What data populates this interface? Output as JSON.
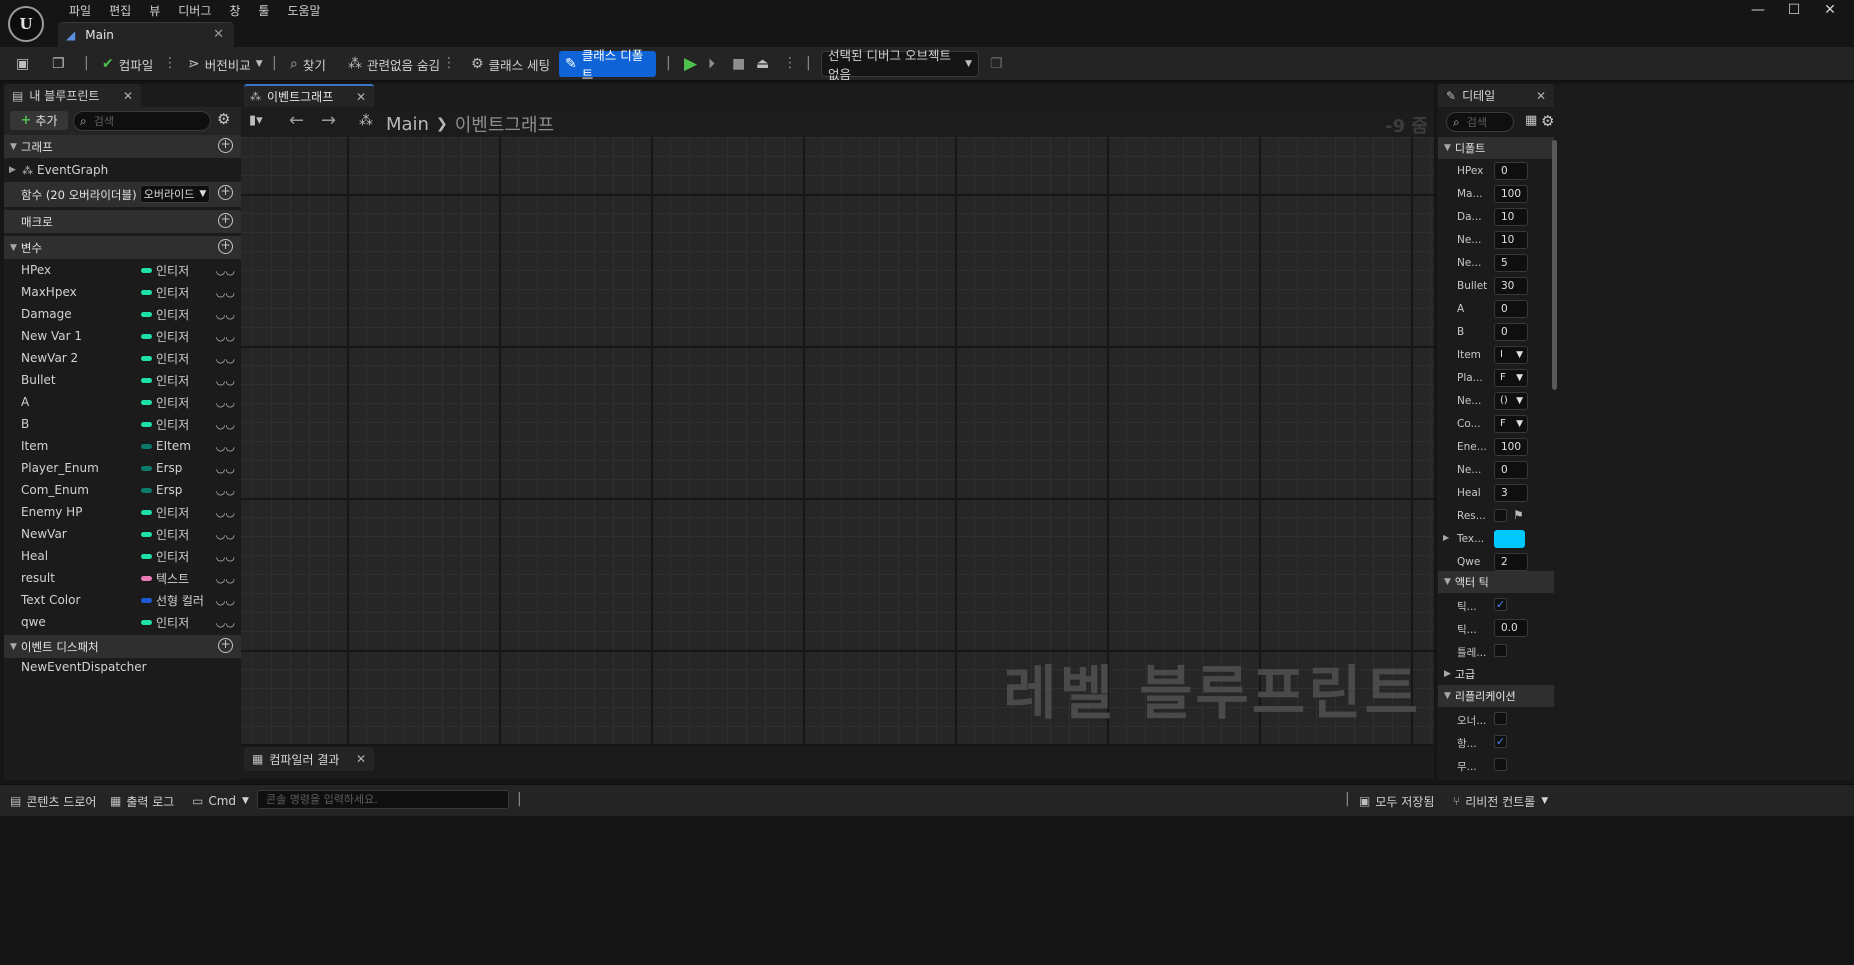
{
  "app": {
    "logo_text": "U",
    "menu": [
      "파일",
      "편집",
      "뷰",
      "디버그",
      "창",
      "툴",
      "도움말"
    ],
    "doc_tab": "Main",
    "window_controls": {
      "minimize": "—",
      "maximize": "☐",
      "close": "✕"
    }
  },
  "toolbar": {
    "compile": "컴파일",
    "diff": "버전비교",
    "find": "찾기",
    "hide_unrelated": "관련없음 숨김",
    "class_settings": "클래스 세팅",
    "class_defaults": "클래스 디폴트",
    "debug_object": "선택된 디버그 오브젝트 없음"
  },
  "left_panel": {
    "tab": "내 블루프린트",
    "add": "추가",
    "search_placeholder": "검색",
    "sections": {
      "graphs": "그래프",
      "functions": "함수 (20 오버라이더블)",
      "override_btn": "오버라이드",
      "macros": "매크로",
      "variables": "변수",
      "dispatchers": "이벤트 디스패처"
    },
    "event_graph": "EventGraph",
    "variables": [
      {
        "name": "HPex",
        "type": "인티저",
        "color": "#1fe0a8"
      },
      {
        "name": "MaxHpex",
        "type": "인티저",
        "color": "#1fe0a8"
      },
      {
        "name": "Damage",
        "type": "인티저",
        "color": "#1fe0a8"
      },
      {
        "name": "New Var 1",
        "type": "인티저",
        "color": "#1fe0a8"
      },
      {
        "name": "NewVar 2",
        "type": "인티저",
        "color": "#1fe0a8"
      },
      {
        "name": "Bullet",
        "type": "인티저",
        "color": "#1fe0a8"
      },
      {
        "name": "A",
        "type": "인티저",
        "color": "#1fe0a8"
      },
      {
        "name": "B",
        "type": "인티저",
        "color": "#1fe0a8"
      },
      {
        "name": "Item",
        "type": "EItem",
        "color": "#0c7a6a"
      },
      {
        "name": "Player_Enum",
        "type": "Ersp",
        "color": "#0c7a6a"
      },
      {
        "name": "Com_Enum",
        "type": "Ersp",
        "color": "#0c7a6a"
      },
      {
        "name": "Enemy HP",
        "type": "인티저",
        "color": "#1fe0a8"
      },
      {
        "name": "NewVar",
        "type": "인티저",
        "color": "#1fe0a8"
      },
      {
        "name": "Heal",
        "type": "인티저",
        "color": "#1fe0a8"
      },
      {
        "name": "result",
        "type": "텍스트",
        "color": "#e87ab5"
      },
      {
        "name": "Text Color",
        "type": "선형 컬러",
        "color": "#1f5ad6"
      },
      {
        "name": "qwe",
        "type": "인티저",
        "color": "#1fe0a8"
      }
    ],
    "dispatcher": "NewEventDispatcher"
  },
  "center": {
    "tab": "이벤트그래프",
    "breadcrumb": [
      "Main",
      "이벤트그래프"
    ],
    "zoom": "-9 줌",
    "watermark": "레벨 블루프린트",
    "compiler_tab": "컴파일러 결과"
  },
  "details": {
    "tab": "디테일",
    "search_placeholder": "검색",
    "section_default": "디폴트",
    "section_tick": "액터 틱",
    "section_advanced": "고급",
    "section_replication": "리플리케이션",
    "rows": [
      {
        "label": "HPex",
        "value": "0",
        "kind": "num"
      },
      {
        "label": "Ma...",
        "value": "100",
        "kind": "num"
      },
      {
        "label": "Da...",
        "value": "10",
        "kind": "num"
      },
      {
        "label": "Ne...",
        "value": "10",
        "kind": "num"
      },
      {
        "label": "Ne...",
        "value": "5",
        "kind": "num"
      },
      {
        "label": "Bullet",
        "value": "30",
        "kind": "num"
      },
      {
        "label": "A",
        "value": "0",
        "kind": "num"
      },
      {
        "label": "B",
        "value": "0",
        "kind": "num"
      },
      {
        "label": "Item",
        "value": "I",
        "kind": "dd"
      },
      {
        "label": "Pla...",
        "value": "F",
        "kind": "dd"
      },
      {
        "label": "Ne...",
        "value": "()",
        "kind": "dd"
      },
      {
        "label": "Co...",
        "value": "F",
        "kind": "dd"
      },
      {
        "label": "Ene...",
        "value": "100",
        "kind": "num"
      },
      {
        "label": "Ne...",
        "value": "0",
        "kind": "num"
      },
      {
        "label": "Heal",
        "value": "3",
        "kind": "num"
      },
      {
        "label": "Res...",
        "value": "",
        "kind": "chk"
      },
      {
        "label": "Tex...",
        "value": "",
        "kind": "color"
      },
      {
        "label": "Qwe",
        "value": "2",
        "kind": "num"
      }
    ],
    "tick_rows": [
      {
        "label": "틱...",
        "value": "✓",
        "kind": "chk"
      },
      {
        "label": "틱...",
        "value": "0.0",
        "kind": "num"
      },
      {
        "label": "틀레...",
        "value": "",
        "kind": "chk"
      }
    ],
    "replication_rows": [
      {
        "label": "오너...",
        "value": "",
        "kind": "chk"
      },
      {
        "label": "항...",
        "value": "✓",
        "kind": "chk"
      },
      {
        "label": "무...",
        "value": "",
        "kind": "chk"
      }
    ],
    "text_color_swatch": "#00c8ff"
  },
  "statusbar": {
    "content_drawer": "콘텐츠 드로어",
    "output_log": "출력 로그",
    "cmd": "Cmd",
    "console_placeholder": "콘솔 명령을 입력하세요.",
    "save_all": "모두 저장됨",
    "revision_control": "리비전 컨트롤"
  }
}
